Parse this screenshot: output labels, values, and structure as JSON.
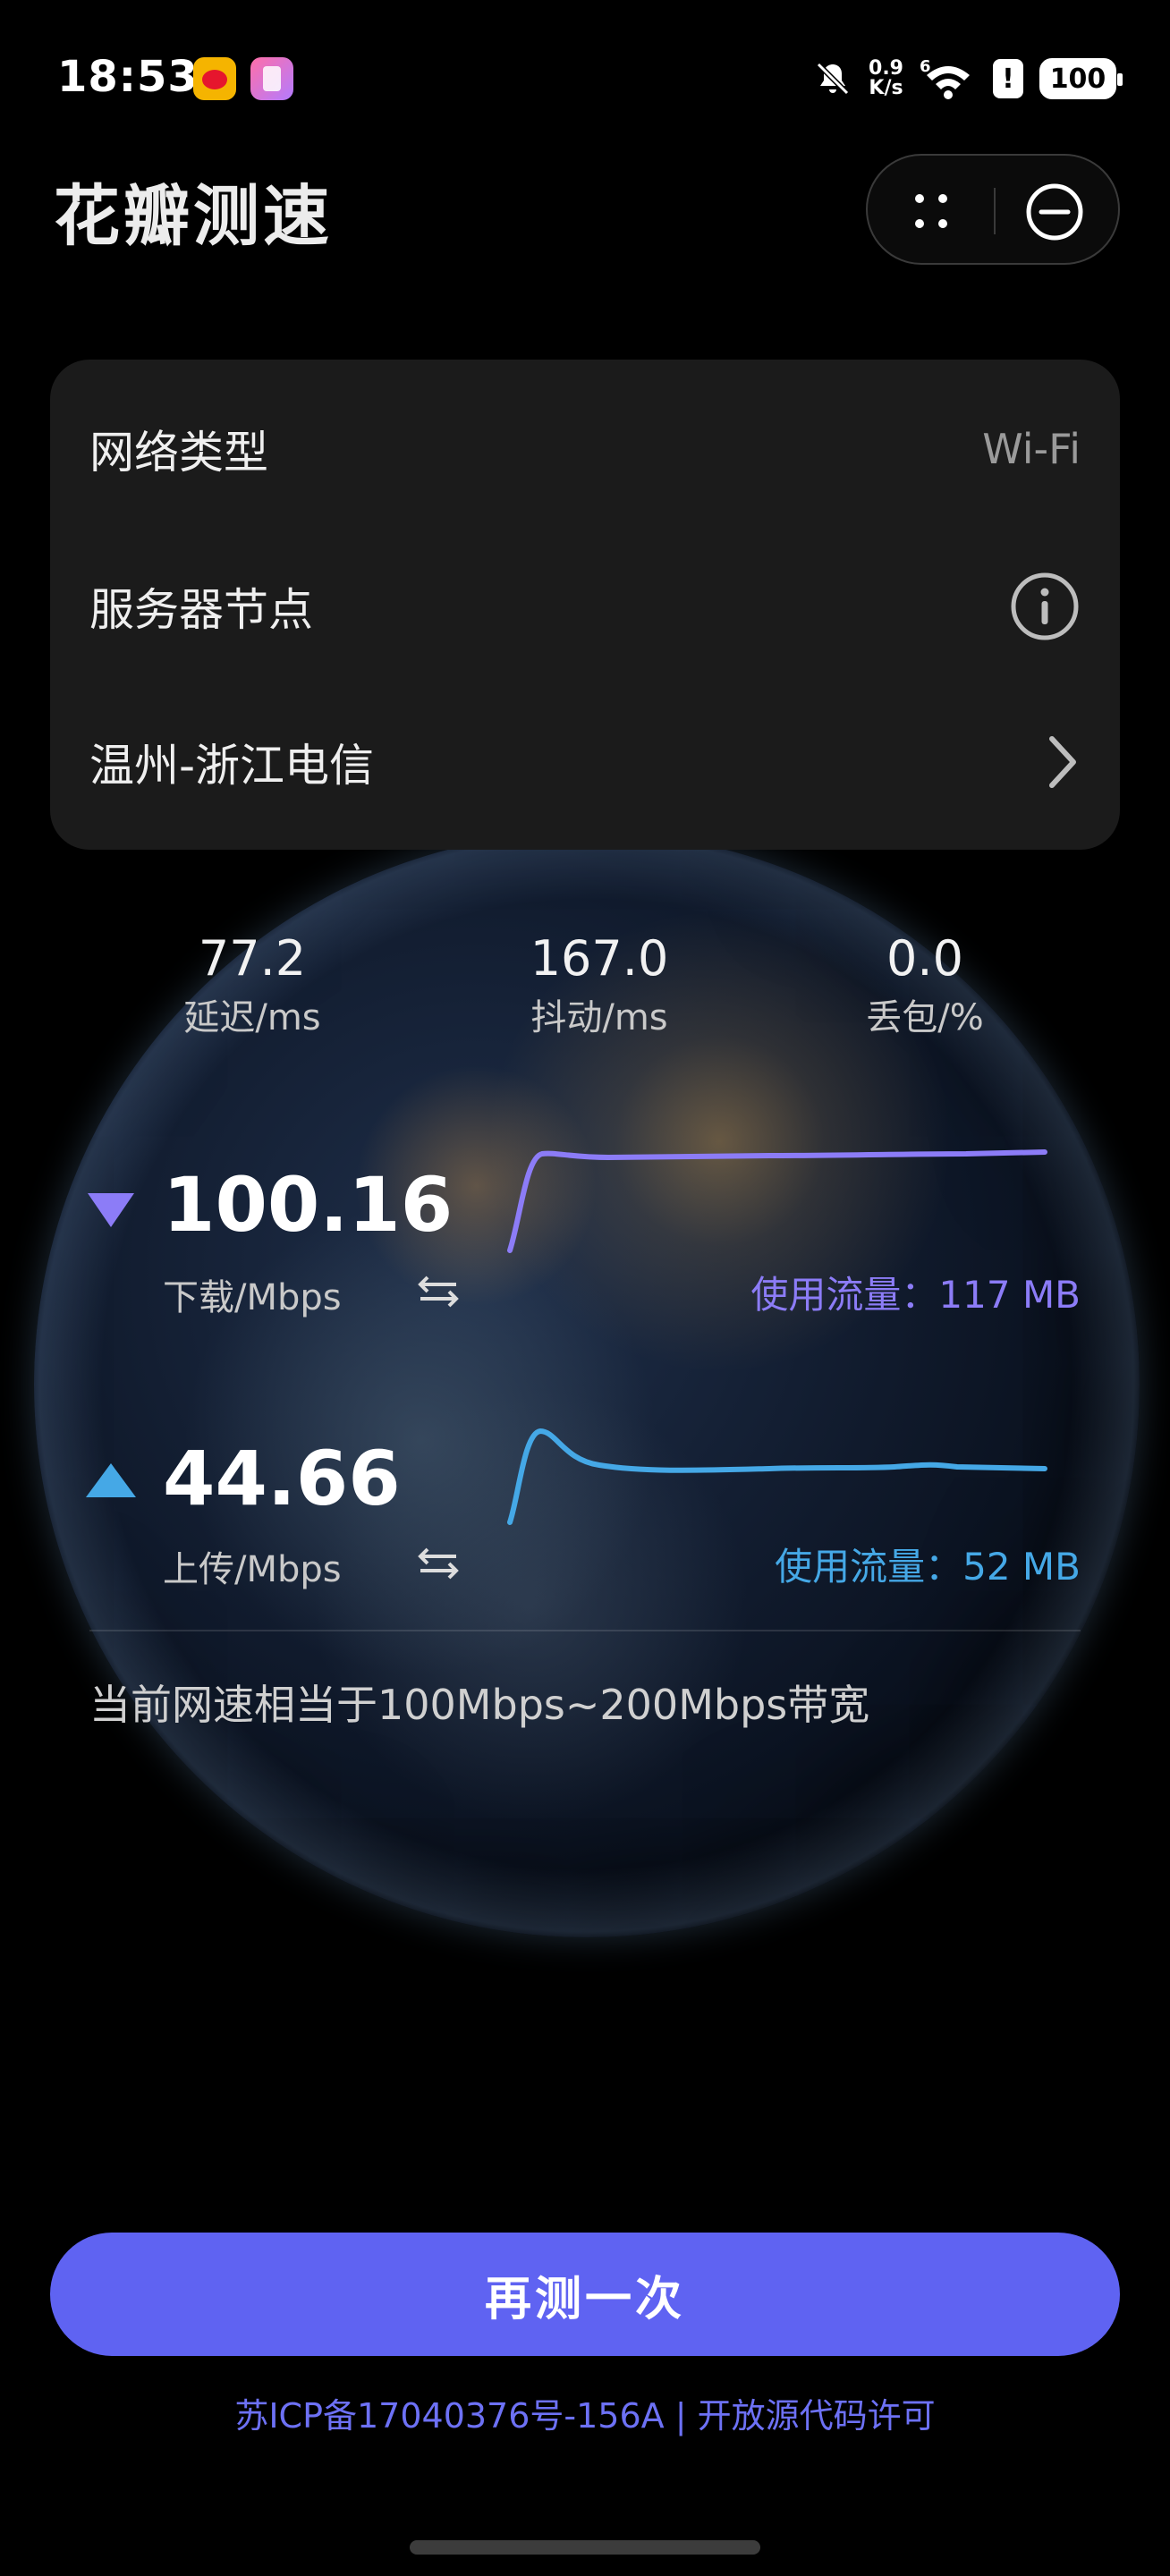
{
  "status_bar": {
    "time": "18:53",
    "net_rate_value": "0.9",
    "net_rate_unit": "K/s",
    "battery": "100",
    "signal_label": "6",
    "alert": "!"
  },
  "header": {
    "title": "花瓣测速"
  },
  "info_card": {
    "network_type_label": "网络类型",
    "network_type_value": "Wi-Fi",
    "server_node_label": "服务器节点",
    "server_name": "温州-浙江电信"
  },
  "stats": {
    "latency_value": "77.2",
    "latency_label": "延迟/ms",
    "jitter_value": "167.0",
    "jitter_label": "抖动/ms",
    "loss_value": "0.0",
    "loss_label": "丢包/%"
  },
  "download": {
    "speed": "100.16",
    "unit": "下载/Mbps",
    "traffic": "使用流量：117 MB",
    "color": "#8c7cf7"
  },
  "upload": {
    "speed": "44.66",
    "unit": "上传/Mbps",
    "traffic": "使用流量：52 MB",
    "color": "#45a8e6"
  },
  "bandwidth_note": "当前网速相当于100Mbps~200Mbps带宽",
  "retest_button": "再测一次",
  "footer": {
    "icp": "苏ICP备17040376号-156A",
    "separator": " | ",
    "license": "开放源代码许可"
  },
  "colors": {
    "accent": "#5f63f2",
    "card_bg": "#1b1b1b"
  }
}
